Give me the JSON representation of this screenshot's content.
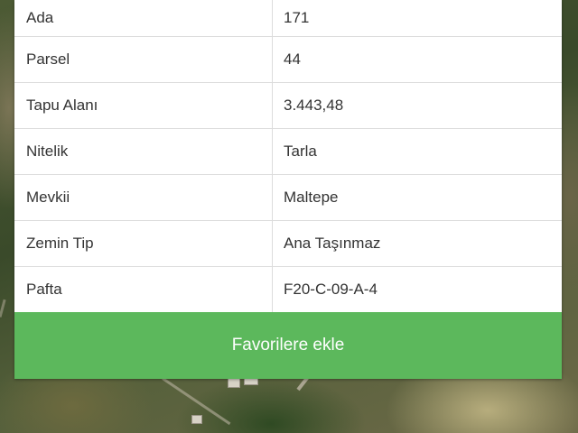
{
  "parcel_info": {
    "rows": [
      {
        "label": "Ada",
        "value": "171"
      },
      {
        "label": "Parsel",
        "value": "44"
      },
      {
        "label": "Tapu Alanı",
        "value": "3.443,48"
      },
      {
        "label": "Nitelik",
        "value": "Tarla"
      },
      {
        "label": "Mevkii",
        "value": "Maltepe"
      },
      {
        "label": "Zemin Tip",
        "value": "Ana Taşınmaz"
      },
      {
        "label": "Pafta",
        "value": "F20-C-09-A-4"
      }
    ]
  },
  "actions": {
    "favorite_label": "Favorilere ekle"
  },
  "colors": {
    "button_green": "#5cb85c",
    "card_background": "#ffffff",
    "divider": "#dcdcdc"
  }
}
